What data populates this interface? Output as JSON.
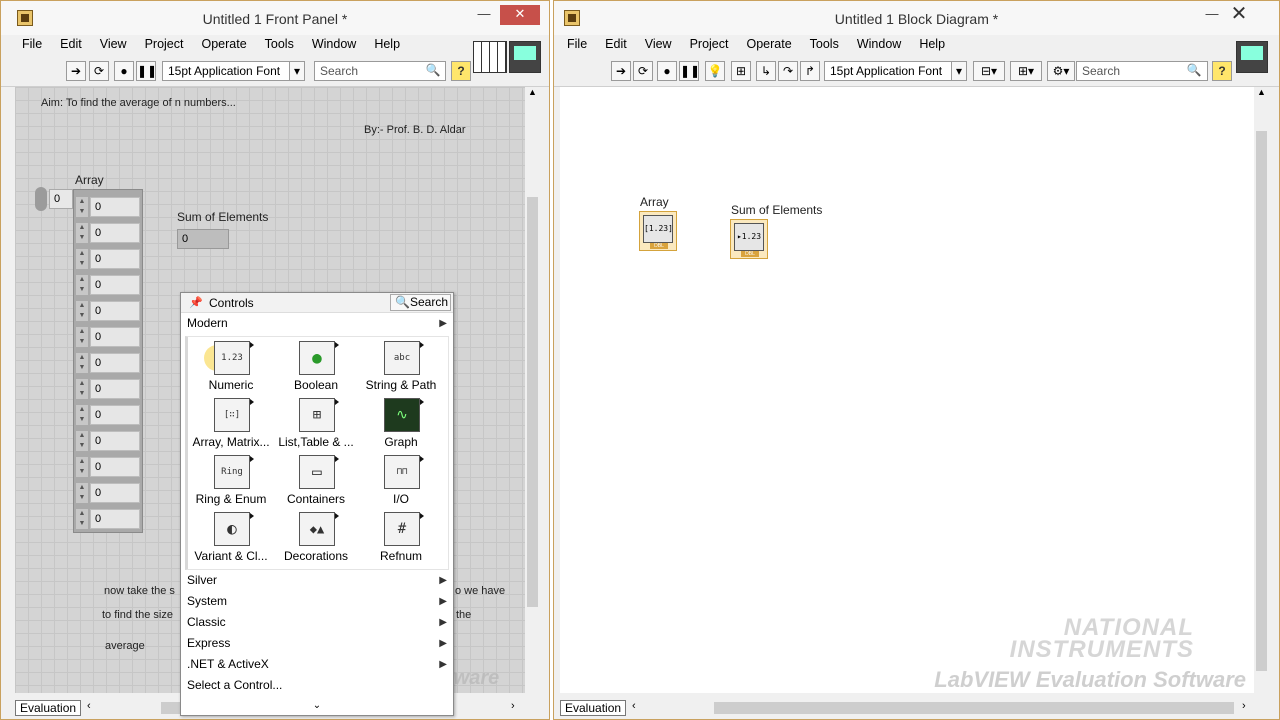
{
  "front_panel": {
    "title": "Untitled 1 Front Panel *",
    "menu": [
      "File",
      "Edit",
      "View",
      "Project",
      "Operate",
      "Tools",
      "Window",
      "Help"
    ],
    "toolbar": {
      "font": "15pt Application Font",
      "search_placeholder": "Search",
      "help": "?"
    },
    "aim_text": "Aim: To find the average of n numbers...",
    "author_text": "By:- Prof. B. D. Aldar",
    "array_label": "Array",
    "array_index": "0",
    "array_values": [
      "0",
      "0",
      "0",
      "0",
      "0",
      "0",
      "0",
      "0",
      "0",
      "0",
      "0",
      "0",
      "0"
    ],
    "sum_label": "Sum of Elements",
    "sum_value": "0",
    "note_lines": [
      "now take the s",
      "to find the size",
      "average"
    ],
    "note_right": [
      "o we have",
      "the"
    ],
    "watermark": "tware",
    "status": "Evaluation"
  },
  "palette": {
    "title": "Controls",
    "search": "Search",
    "top_category": "Modern",
    "items": [
      {
        "label": "Numeric",
        "glyph": "1.23"
      },
      {
        "label": "Boolean",
        "glyph": "●"
      },
      {
        "label": "String & Path",
        "glyph": "abc"
      },
      {
        "label": "Array, Matrix...",
        "glyph": "[∷]"
      },
      {
        "label": "List,Table & ...",
        "glyph": "⊞"
      },
      {
        "label": "Graph",
        "glyph": "∿"
      },
      {
        "label": "Ring & Enum",
        "glyph": "Ring"
      },
      {
        "label": "Containers",
        "glyph": "▭"
      },
      {
        "label": "I/O",
        "glyph": "⊓⊓"
      },
      {
        "label": "Variant & Cl...",
        "glyph": "◐"
      },
      {
        "label": "Decorations",
        "glyph": "◆▲"
      },
      {
        "label": "Refnum",
        "glyph": "#"
      }
    ],
    "categories": [
      "Silver",
      "System",
      "Classic",
      "Express",
      ".NET & ActiveX",
      "Select a Control..."
    ],
    "more_chevron": "⌄"
  },
  "block_diagram": {
    "title": "Untitled 1 Block Diagram *",
    "menu": [
      "File",
      "Edit",
      "View",
      "Project",
      "Operate",
      "Tools",
      "Window",
      "Help"
    ],
    "toolbar": {
      "font": "15pt Application Font",
      "search_placeholder": "Search",
      "help": "?"
    },
    "array_terminal_label": "Array",
    "array_terminal_glyph": "[1.23]",
    "sum_terminal_label": "Sum of Elements",
    "sum_terminal_glyph": "▸1.23",
    "terminal_tag": "DBL",
    "watermark_line1": "NATIONAL",
    "watermark_line2": "INSTRUMENTS",
    "watermark_line3": "LabVIEW Evaluation Software",
    "status": "Evaluation"
  }
}
